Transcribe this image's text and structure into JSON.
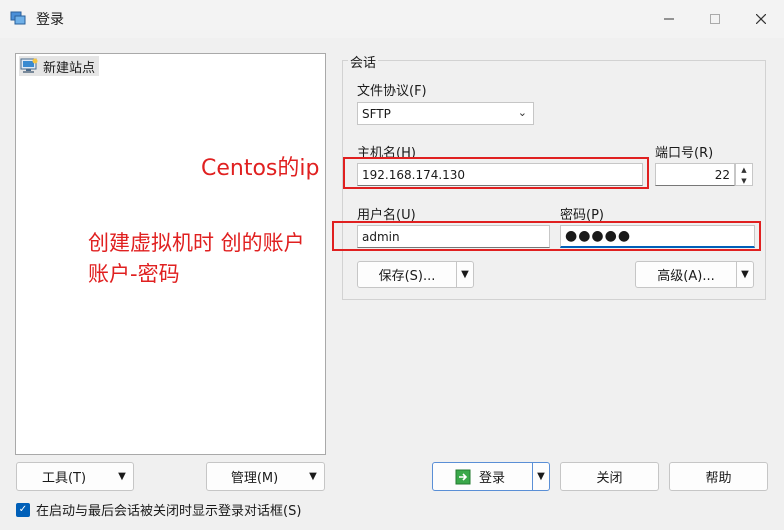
{
  "window": {
    "title": "登录"
  },
  "tree": {
    "items": [
      {
        "label": "新建站点"
      }
    ]
  },
  "session": {
    "group_title": "会话",
    "protocol_label": "文件协议(F)",
    "protocol_value": "SFTP",
    "host_label": "主机名(H)",
    "host_value": "192.168.174.130",
    "port_label": "端口号(R)",
    "port_value": "22",
    "user_label": "用户名(U)",
    "user_value": "admin",
    "password_label": "密码(P)",
    "password_value": "●●●●●",
    "save_label": "保存(S)...",
    "advanced_label": "高级(A)..."
  },
  "footer": {
    "tools_label": "工具(T)",
    "manage_label": "管理(M)",
    "login_label": "登录",
    "close_label": "关闭",
    "help_label": "帮助",
    "checkbox_label": "在启动与最后会话被关闭时显示登录对话框(S)",
    "checkbox_checked": true
  },
  "annotations": {
    "host_note": "Centos的ip",
    "account_note_line1": "创建虚拟机时 创的账户",
    "account_note_line2": "账户-密码"
  },
  "colors": {
    "accent": "#005fb8",
    "annotation": "#e02020"
  }
}
